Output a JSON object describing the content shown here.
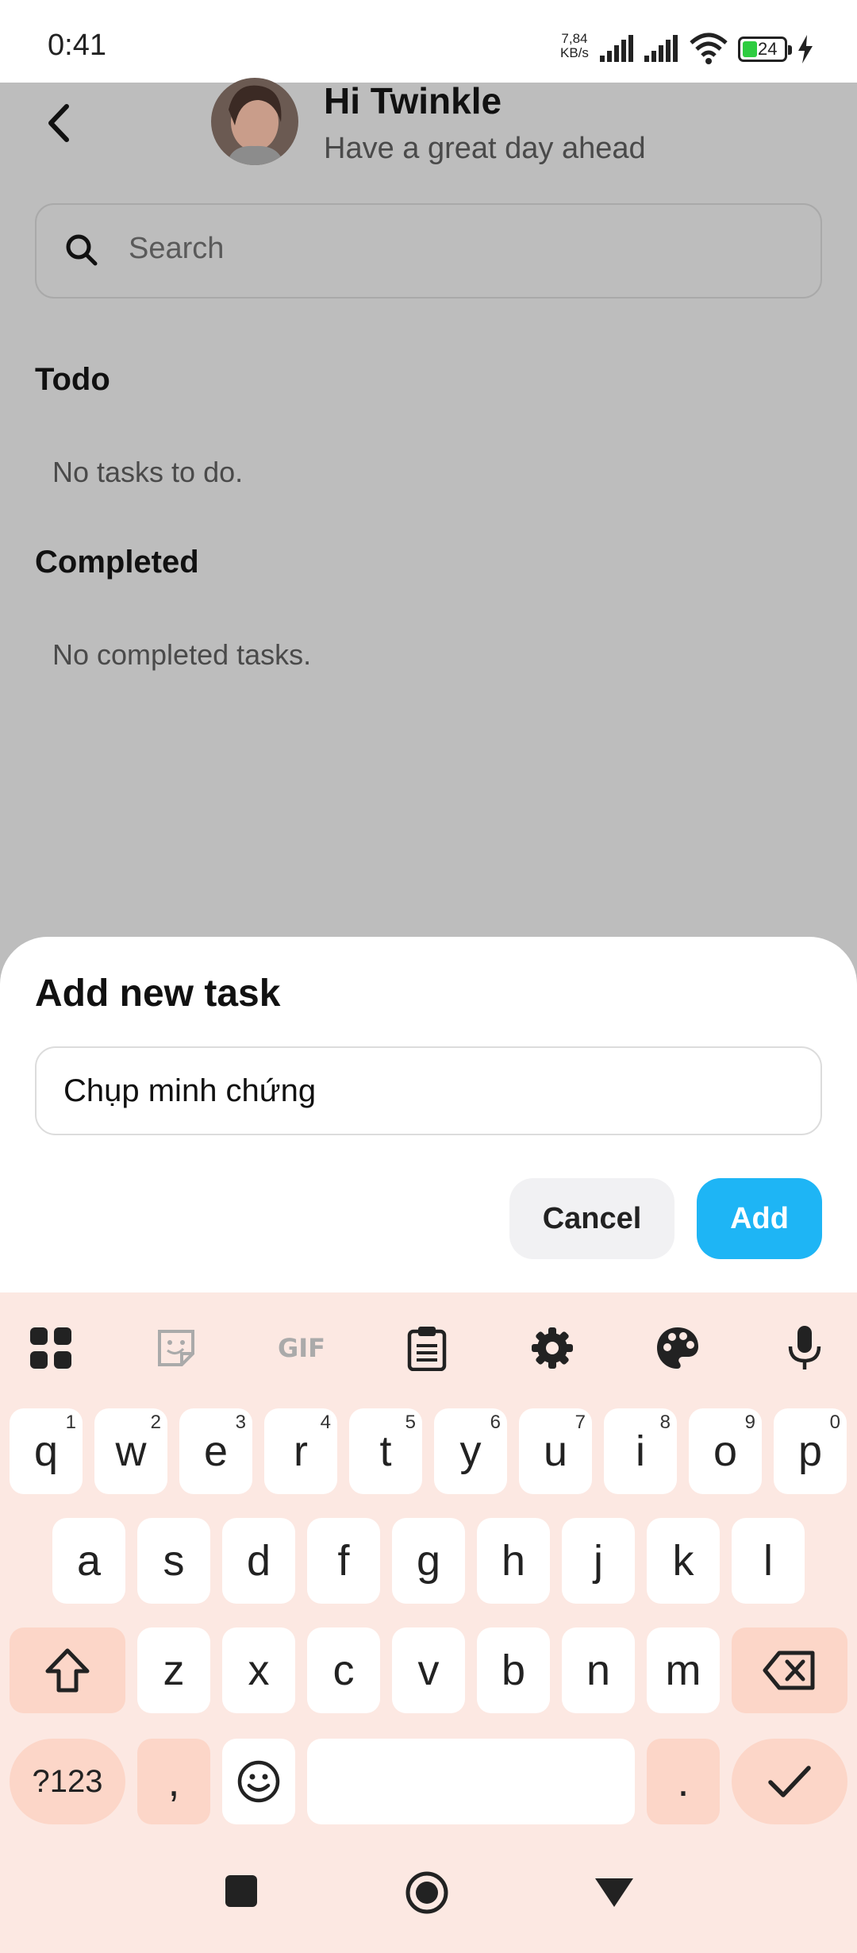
{
  "status_bar": {
    "time": "0:41",
    "net_speed_value": "7,84",
    "net_speed_unit": "KB/s",
    "battery": "24"
  },
  "header": {
    "back_icon": "chevron-left-icon",
    "title": "Hi Twinkle",
    "subtitle": "Have a great day ahead"
  },
  "search": {
    "placeholder": "Search"
  },
  "sections": {
    "todo_heading": "Todo",
    "todo_empty": "No tasks to do.",
    "completed_heading": "Completed",
    "completed_empty": "No completed tasks."
  },
  "dialog": {
    "title": "Add new task",
    "input_value": "Chụp minh chứng",
    "cancel_label": "Cancel",
    "add_label": "Add"
  },
  "keyboard": {
    "toolbar": [
      "apps-icon",
      "sticker-icon",
      "gif-icon",
      "clipboard-icon",
      "settings-icon",
      "palette-icon",
      "mic-icon"
    ],
    "gif_label": "GIF",
    "row1": [
      {
        "k": "q",
        "h": "1"
      },
      {
        "k": "w",
        "h": "2"
      },
      {
        "k": "e",
        "h": "3"
      },
      {
        "k": "r",
        "h": "4"
      },
      {
        "k": "t",
        "h": "5"
      },
      {
        "k": "y",
        "h": "6"
      },
      {
        "k": "u",
        "h": "7"
      },
      {
        "k": "i",
        "h": "8"
      },
      {
        "k": "o",
        "h": "9"
      },
      {
        "k": "p",
        "h": "0"
      }
    ],
    "row2": [
      "a",
      "s",
      "d",
      "f",
      "g",
      "h",
      "j",
      "k",
      "l"
    ],
    "row3": [
      "z",
      "x",
      "c",
      "v",
      "b",
      "n",
      "m"
    ],
    "symbols_label": "?123",
    "comma_label": ",",
    "period_label": "."
  },
  "colors": {
    "accent": "#1eb5f5",
    "keyboard_bg": "#fce8e2",
    "key_dark": "#fcd6c8",
    "dim_overlay": "#bdbdbd"
  }
}
